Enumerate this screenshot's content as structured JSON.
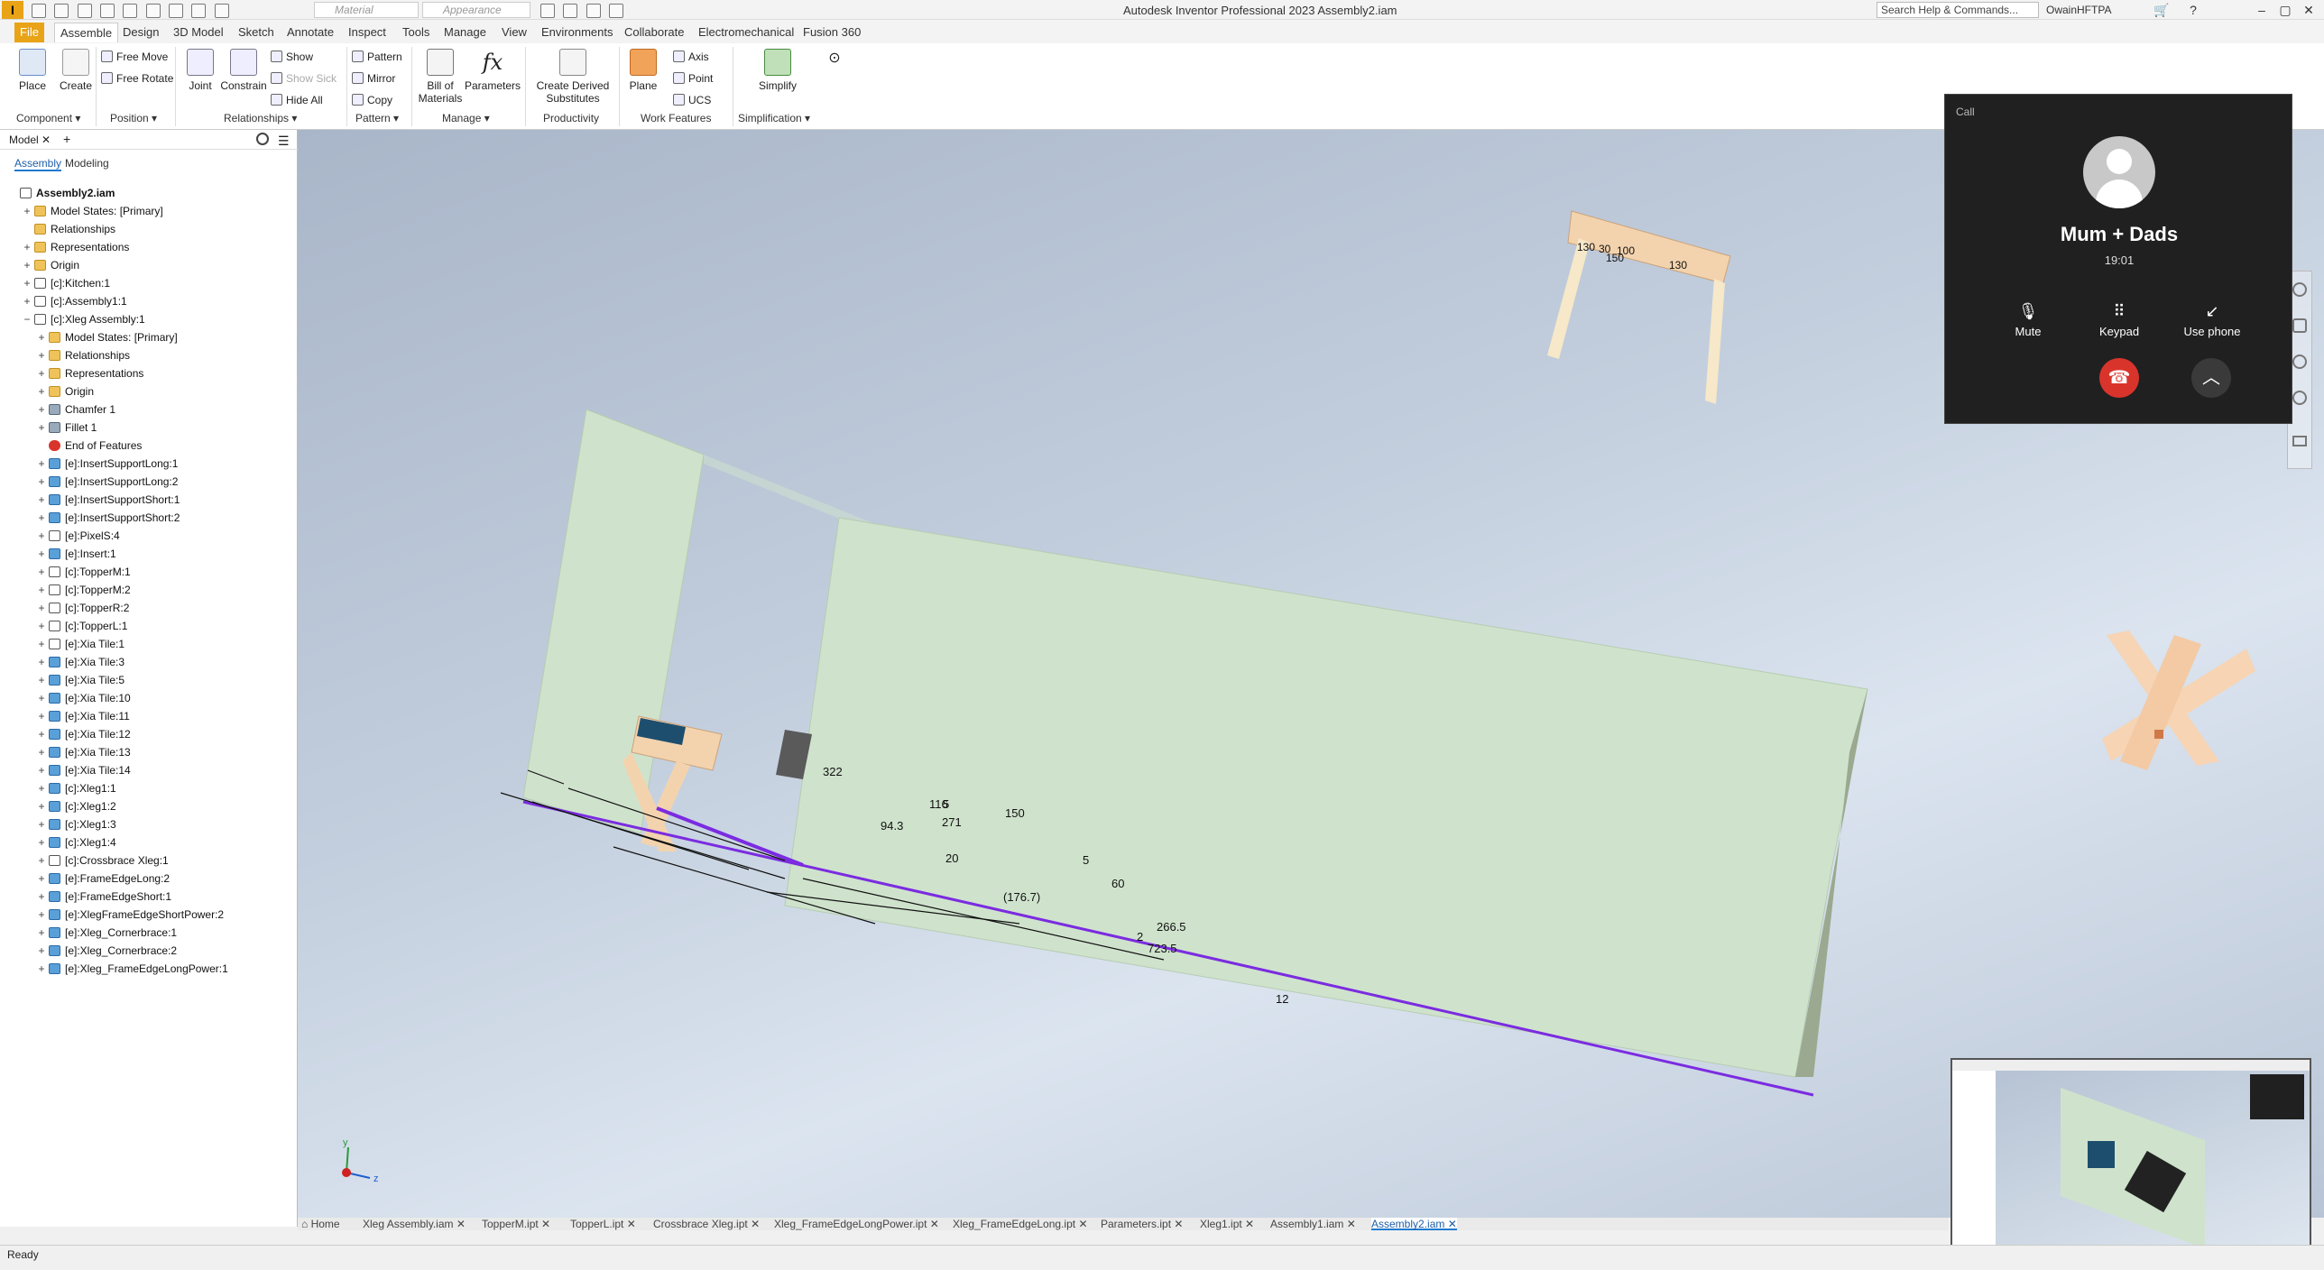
{
  "titlebar": {
    "app_logo": "I",
    "material_placeholder": "Material",
    "appearance_placeholder": "Appearance",
    "window_title": "Autodesk Inventor Professional 2023    Assembly2.iam",
    "search": "Search Help & Commands...",
    "user": "OwainHFTPA",
    "minimize": "–",
    "maximize": "▢",
    "close": "✕",
    "help_icon": "?",
    "cart_icon": "🛒"
  },
  "ribbon_tabs": [
    "File",
    "Assemble",
    "Design",
    "3D Model",
    "Sketch",
    "Annotate",
    "Inspect",
    "Tools",
    "Manage",
    "View",
    "Environments",
    "Collaborate",
    "Electromechanical",
    "Fusion 360"
  ],
  "ribbon": {
    "place": "Place",
    "create": "Create",
    "free_move": "Free Move",
    "free_rotate": "Free Rotate",
    "joint": "Joint",
    "constrain": "Constrain",
    "show": "Show",
    "show_sick": "Show Sick",
    "hide_all": "Hide All",
    "pattern": "Pattern",
    "mirror": "Mirror",
    "copy": "Copy",
    "bill_of_materials_1": "Bill of",
    "bill_of_materials_2": "Materials",
    "parameters": "Parameters",
    "create_derived_1": "Create Derived",
    "create_derived_2": "Substitutes",
    "plane": "Plane",
    "axis": "Axis",
    "point": "Point",
    "ucs": "UCS",
    "simplify": "Simplify",
    "groups": {
      "component": "Component ▾",
      "position": "Position ▾",
      "relationships": "Relationships ▾",
      "pattern": "Pattern ▾",
      "manage": "Manage ▾",
      "productivity": "Productivity",
      "work_features": "Work Features",
      "simplification": "Simplification ▾"
    }
  },
  "browser": {
    "tab_model": "Model",
    "tab_close": "✕",
    "tab_add": "+",
    "subtab_assembly": "Assembly",
    "subtab_modeling": "Modeling",
    "rows": [
      {
        "label": "Assembly2.iam",
        "indent": 0,
        "icon": "asm",
        "exp": ""
      },
      {
        "label": "Model States: [Primary]",
        "indent": 1,
        "icon": "folder",
        "exp": "+"
      },
      {
        "label": "Relationships",
        "indent": 1,
        "icon": "folder",
        "exp": ""
      },
      {
        "label": "Representations",
        "indent": 1,
        "icon": "folder",
        "exp": "+"
      },
      {
        "label": "Origin",
        "indent": 1,
        "icon": "folder",
        "exp": "+"
      },
      {
        "label": "[c]:Kitchen:1",
        "indent": 1,
        "icon": "asm",
        "exp": "+"
      },
      {
        "label": "[c]:Assembly1:1",
        "indent": 1,
        "icon": "asm",
        "exp": "+"
      },
      {
        "label": "[c]:Xleg Assembly:1",
        "indent": 1,
        "icon": "asm",
        "exp": "−"
      },
      {
        "label": "Model States: [Primary]",
        "indent": 2,
        "icon": "folder",
        "exp": "+"
      },
      {
        "label": "Relationships",
        "indent": 2,
        "icon": "folder",
        "exp": "+"
      },
      {
        "label": "Representations",
        "indent": 2,
        "icon": "folder",
        "exp": "+"
      },
      {
        "label": "Origin",
        "indent": 2,
        "icon": "folder",
        "exp": "+"
      },
      {
        "label": "Chamfer 1",
        "indent": 2,
        "icon": "feat",
        "exp": "+"
      },
      {
        "label": "Fillet 1",
        "indent": 2,
        "icon": "feat",
        "exp": "+"
      },
      {
        "label": "End of Features",
        "indent": 2,
        "icon": "error",
        "exp": ""
      },
      {
        "label": "[e]:InsertSupportLong:1",
        "indent": 2,
        "icon": "part",
        "exp": "+"
      },
      {
        "label": "[e]:InsertSupportLong:2",
        "indent": 2,
        "icon": "part",
        "exp": "+"
      },
      {
        "label": "[e]:InsertSupportShort:1",
        "indent": 2,
        "icon": "part",
        "exp": "+"
      },
      {
        "label": "[e]:InsertSupportShort:2",
        "indent": 2,
        "icon": "part",
        "exp": "+"
      },
      {
        "label": "[e]:PixelS:4",
        "indent": 2,
        "icon": "asm",
        "exp": "+"
      },
      {
        "label": "[e]:Insert:1",
        "indent": 2,
        "icon": "part",
        "exp": "+"
      },
      {
        "label": "[c]:TopperM:1",
        "indent": 2,
        "icon": "asm",
        "exp": "+"
      },
      {
        "label": "[c]:TopperM:2",
        "indent": 2,
        "icon": "asm",
        "exp": "+"
      },
      {
        "label": "[c]:TopperR:2",
        "indent": 2,
        "icon": "asm",
        "exp": "+"
      },
      {
        "label": "[c]:TopperL:1",
        "indent": 2,
        "icon": "asm",
        "exp": "+"
      },
      {
        "label": "[e]:Xia Tile:1",
        "indent": 2,
        "icon": "asm",
        "exp": "+"
      },
      {
        "label": "[e]:Xia Tile:3",
        "indent": 2,
        "icon": "part",
        "exp": "+"
      },
      {
        "label": "[e]:Xia Tile:5",
        "indent": 2,
        "icon": "part",
        "exp": "+"
      },
      {
        "label": "[e]:Xia Tile:10",
        "indent": 2,
        "icon": "part",
        "exp": "+"
      },
      {
        "label": "[e]:Xia Tile:11",
        "indent": 2,
        "icon": "part",
        "exp": "+"
      },
      {
        "label": "[e]:Xia Tile:12",
        "indent": 2,
        "icon": "part",
        "exp": "+"
      },
      {
        "label": "[e]:Xia Tile:13",
        "indent": 2,
        "icon": "part",
        "exp": "+"
      },
      {
        "label": "[e]:Xia Tile:14",
        "indent": 2,
        "icon": "part",
        "exp": "+"
      },
      {
        "label": "[c]:Xleg1:1",
        "indent": 2,
        "icon": "part",
        "exp": "+"
      },
      {
        "label": "[c]:Xleg1:2",
        "indent": 2,
        "icon": "part",
        "exp": "+"
      },
      {
        "label": "[c]:Xleg1:3",
        "indent": 2,
        "icon": "part",
        "exp": "+"
      },
      {
        "label": "[c]:Xleg1:4",
        "indent": 2,
        "icon": "part",
        "exp": "+"
      },
      {
        "label": "[c]:Crossbrace Xleg:1",
        "indent": 2,
        "icon": "asm",
        "exp": "+"
      },
      {
        "label": "[e]:FrameEdgeLong:2",
        "indent": 2,
        "icon": "part",
        "exp": "+"
      },
      {
        "label": "[e]:FrameEdgeShort:1",
        "indent": 2,
        "icon": "part",
        "exp": "+"
      },
      {
        "label": "[e]:XlegFrameEdgeShortPower:2",
        "indent": 2,
        "icon": "part",
        "exp": "+"
      },
      {
        "label": "[e]:Xleg_Cornerbrace:1",
        "indent": 2,
        "icon": "part",
        "exp": "+"
      },
      {
        "label": "[e]:Xleg_Cornerbrace:2",
        "indent": 2,
        "icon": "part",
        "exp": "+"
      },
      {
        "label": "[e]:Xleg_FrameEdgeLongPower:1",
        "indent": 2,
        "icon": "part",
        "exp": "+"
      }
    ]
  },
  "viewport": {
    "dimensions": [
      "322",
      "116",
      "94.3",
      "271",
      "5",
      "150",
      "20",
      "(176.7)",
      "5",
      "60",
      "266.5",
      "2",
      "723.5",
      "12"
    ],
    "top_dims": [
      "130",
      "30",
      "150",
      "100",
      "130"
    ],
    "axis_x": "x",
    "axis_y": "y",
    "axis_z": "z"
  },
  "doc_tabs": [
    "Home",
    "Xleg Assembly.iam",
    "TopperM.ipt",
    "TopperL.ipt",
    "Crossbrace Xleg.ipt",
    "Xleg_FrameEdgeLongPower.ipt",
    "Xleg_FrameEdgeLong.ipt",
    "Parameters.ipt",
    "Xleg1.ipt",
    "Assembly1.iam",
    "Assembly2.iam"
  ],
  "doc_tab_close": "✕",
  "status": "Ready",
  "call": {
    "header": "Call",
    "name": "Mum + Dads",
    "time": "19:01",
    "mute": "Mute",
    "keypad": "Keypad",
    "use_phone": "Use phone",
    "hangup_icon": "☎",
    "expand_icon": "︿"
  },
  "colors": {
    "accent_orange": "#e8a317",
    "frame_green": "#cfe3cc",
    "dim_purple": "#7b2be0",
    "wood": "#f3d3ae",
    "call_bg": "#202020",
    "hangup_red": "#d9342b"
  }
}
